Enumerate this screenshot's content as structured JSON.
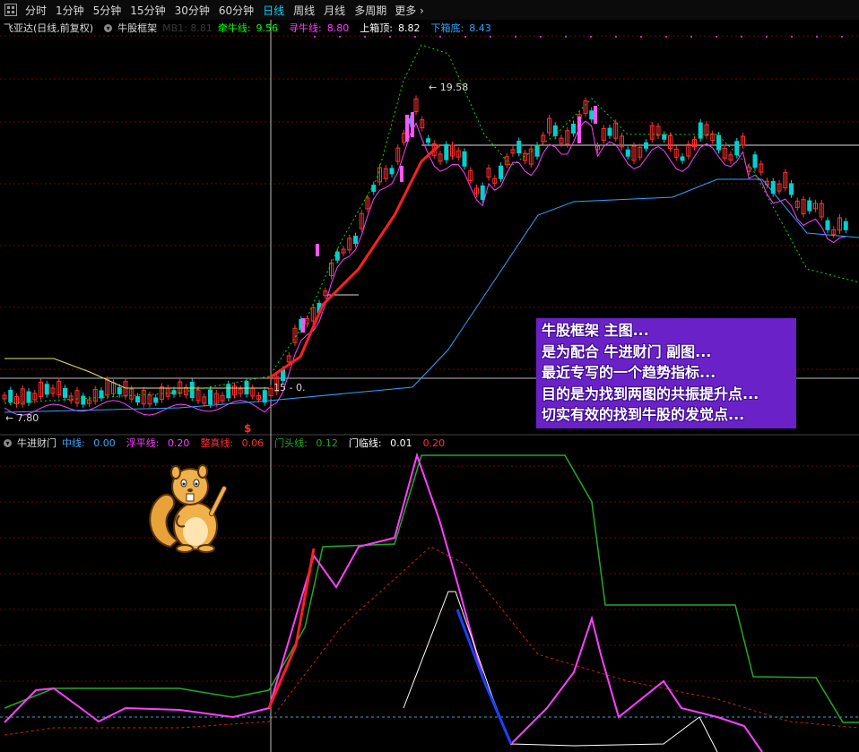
{
  "toolbar": {
    "tabs": [
      "分时",
      "1分钟",
      "5分钟",
      "15分钟",
      "30分钟",
      "60分钟",
      "日线",
      "周线",
      "月线",
      "多周期"
    ],
    "active_tab": "日线",
    "more_label": "更多",
    "more_icon": "chevron-right-icon"
  },
  "main_chart": {
    "stock_name": "飞亚达(日线,前复权)",
    "indicator_name": "牛股框架",
    "faded_label": "MB1: 8.81",
    "lines": [
      {
        "label": "牵牛线:",
        "value": "9.56",
        "color": "#00ff00"
      },
      {
        "label": "寻牛线:",
        "value": "8.80",
        "color": "#ff40ff"
      },
      {
        "label": "上箱顶:",
        "value": "8.82",
        "color": "#ffffff"
      },
      {
        "label": "下箱底:",
        "value": "8.43",
        "color": "#2ea3ff"
      }
    ],
    "high_label": "19.58",
    "low_label": "7.80",
    "cursor_label": "15 - 0.",
    "dollar_marker": "$"
  },
  "sub_chart": {
    "indicator_name": "牛进财门",
    "lines": [
      {
        "label": "中线:",
        "value": "0.00",
        "color": "#3fa9ff"
      },
      {
        "label": "浮平线:",
        "value": "0.20",
        "color": "#ff40ff"
      },
      {
        "label": "整真线:",
        "value": "0.06",
        "color": "#ff3030"
      },
      {
        "label": "门头线:",
        "value": "0.12",
        "color": "#22aa22"
      },
      {
        "label": "门临线:",
        "value": "0.01",
        "color": "#ffffff"
      },
      {
        "label": "",
        "value": "0.20",
        "color": "#ff3030"
      }
    ]
  },
  "annotation": {
    "lines": [
      "牛股框架 主图...",
      "是为配合 牛进财门 副图...",
      "最近专写的一个趋势指标...",
      "目的是为找到两图的共振提升点...",
      "切实有效的找到牛股的发觉点..."
    ]
  },
  "colors": {
    "up": "#ff3030",
    "down": "#00d0d0",
    "grid": "#7a0000",
    "cursor": "#bbbbbb",
    "green_line": "#00e000",
    "magenta_line": "#ff40ff",
    "blue_line": "#2ea3ff"
  }
}
